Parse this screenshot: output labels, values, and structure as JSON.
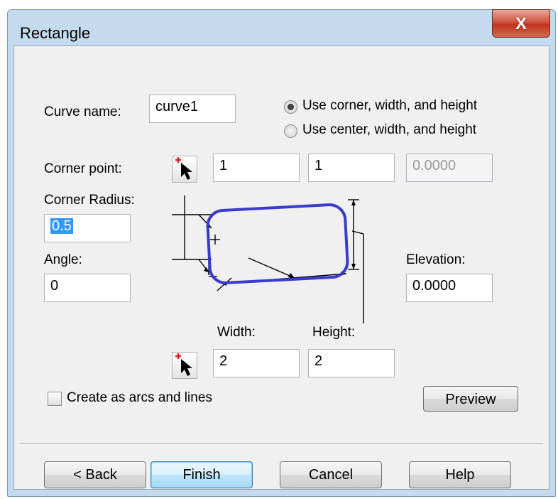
{
  "window": {
    "title": "Rectangle",
    "close_label": "X"
  },
  "curve_name": {
    "label": "Curve name:",
    "value": "curve1"
  },
  "mode": {
    "options": [
      "Use corner, width, and height",
      "Use center, width, and height"
    ],
    "selected": 0
  },
  "corner_point": {
    "label": "Corner point:",
    "x": "1",
    "y": "1",
    "z": "0.0000"
  },
  "corner_radius": {
    "label": "Corner Radius:",
    "value": "0.5"
  },
  "angle": {
    "label": "Angle:",
    "value": "0"
  },
  "elevation": {
    "label": "Elevation:",
    "value": "0.0000"
  },
  "size": {
    "width_label": "Width:",
    "height_label": "Height:",
    "width_value": "2",
    "height_value": "2"
  },
  "create_arcs": {
    "label": "Create as arcs and lines",
    "checked": false
  },
  "buttons": {
    "preview": "Preview",
    "back": "< Back",
    "finish": "Finish",
    "cancel": "Cancel",
    "help": "Help"
  },
  "colors": {
    "diagram_stroke": "#3a3acc",
    "dialog_bg": "#f0f0f0",
    "close_button": "#c9412a"
  }
}
